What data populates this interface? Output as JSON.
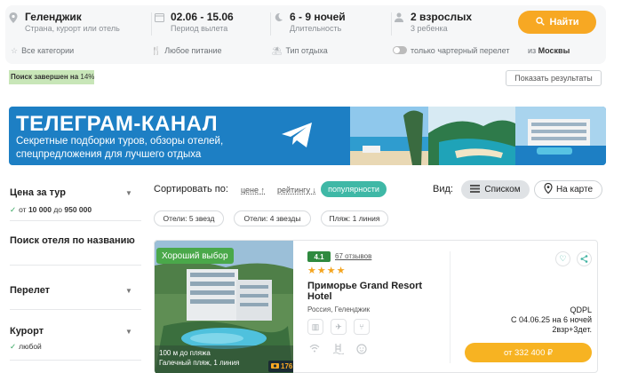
{
  "search": {
    "destination": {
      "value": "Геленджик",
      "sub": "Страна, курорт или отель"
    },
    "dates": {
      "value": "02.06 - 15.06",
      "sub": "Период вылета"
    },
    "nights": {
      "value": "6 - 9 ночей",
      "sub": "Длительность"
    },
    "guests": {
      "value": "2 взрослых",
      "sub": "3 ребенка"
    },
    "find_button": "Найти",
    "filters": {
      "categories": "Все категории",
      "meals": "Любое питание",
      "rest_type": "Тип отдыха",
      "charter_only": "только чартерный перелет",
      "from_prefix": "из",
      "from_city": "Москвы"
    }
  },
  "progress": {
    "label": "Поиск завершен на",
    "percent_text": "14%",
    "percent": 14
  },
  "show_results_button": "Показать результаты",
  "banner": {
    "title": "ТЕЛЕГРАМ-КАНАЛ",
    "subtitle": "Секретные подборки туров, обзоры отелей, спецпредложения для лучшего отдыха"
  },
  "sidebar": {
    "price": {
      "title": "Цена за тур",
      "range_from_label": "от",
      "range_from": "10 000",
      "range_to_label": "до",
      "range_to": "950 000"
    },
    "hotel_search": {
      "title": "Поиск отеля по названию"
    },
    "flight": {
      "title": "Перелет"
    },
    "resort": {
      "title": "Курорт",
      "value": "любой"
    }
  },
  "sort": {
    "label": "Сортировать по:",
    "options": [
      "цене",
      "рейтингу",
      "популярности"
    ],
    "active": "популярности"
  },
  "view": {
    "label": "Вид:",
    "list": "Списком",
    "map": "На карте"
  },
  "chips": [
    "Отели: 5 звезд",
    "Отели: 4 звезды",
    "Пляж: 1 линия"
  ],
  "hotel": {
    "badge": "Хороший выбор",
    "rating": "4.1",
    "reviews": "67 отзывов",
    "stars": 4,
    "name": "Приморье Grand Resort Hotel",
    "location": "Россия, Геленджик",
    "beach_distance": "100 м до пляжа",
    "beach_type": "Галечный пляж, 1 линия",
    "photo_count": "176",
    "operator": "QDPL",
    "dates": "С 04.06.25 на 6 ночей",
    "guests": "2взр+3дет.",
    "price": "от 332 400 ₽"
  },
  "colors": {
    "accent": "#f7a823",
    "teal": "#3fb8a6",
    "banner": "#1d7fc4",
    "good": "#4aa84a",
    "rating": "#2f8a3f"
  }
}
